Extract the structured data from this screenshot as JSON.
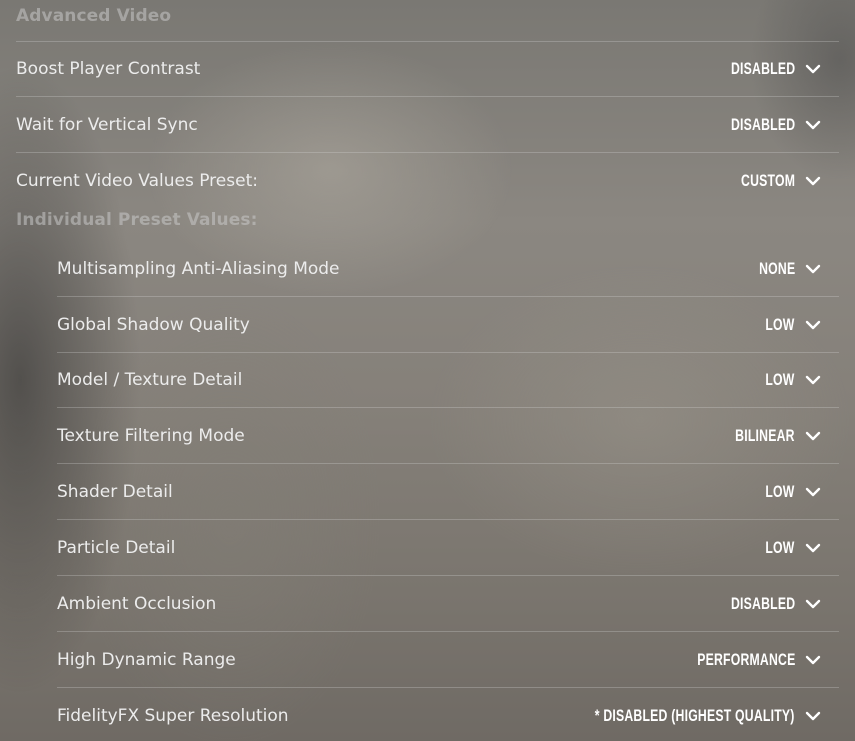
{
  "section_title": "Advanced Video",
  "main_settings": [
    {
      "label": "Boost Player Contrast",
      "value": "DISABLED"
    },
    {
      "label": "Wait for Vertical Sync",
      "value": "DISABLED"
    },
    {
      "label": "Current Video Values Preset:",
      "value": "CUSTOM"
    }
  ],
  "preset_title": "Individual Preset Values:",
  "preset_settings": [
    {
      "label": "Multisampling Anti-Aliasing Mode",
      "value": "NONE"
    },
    {
      "label": "Global Shadow Quality",
      "value": "LOW"
    },
    {
      "label": "Model / Texture Detail",
      "value": "LOW"
    },
    {
      "label": "Texture Filtering Mode",
      "value": "BILINEAR"
    },
    {
      "label": "Shader Detail",
      "value": "LOW"
    },
    {
      "label": "Particle Detail",
      "value": "LOW"
    },
    {
      "label": "Ambient Occlusion",
      "value": "DISABLED"
    },
    {
      "label": "High Dynamic Range",
      "value": "PERFORMANCE"
    },
    {
      "label": "FidelityFX Super Resolution",
      "value": "* DISABLED (HIGHEST QUALITY)"
    }
  ],
  "icons": {
    "dropdown": "chevron-down-icon"
  },
  "colors": {
    "text": "#ececec",
    "value": "#ffffff",
    "section": "#c8c8c8"
  }
}
